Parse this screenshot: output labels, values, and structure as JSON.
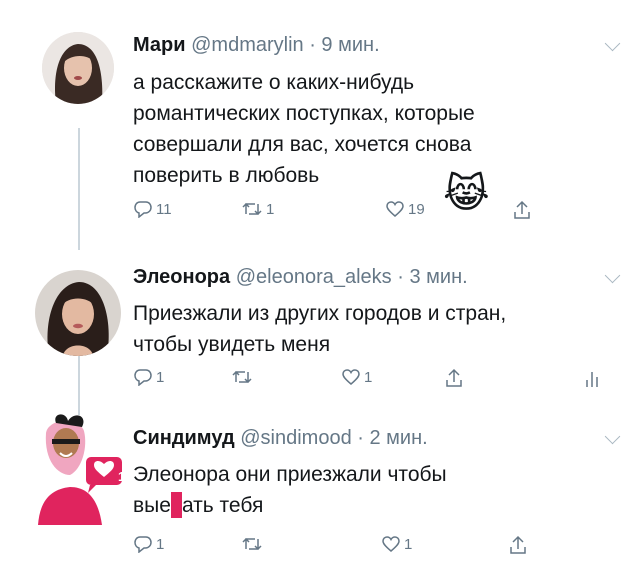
{
  "tweets": [
    {
      "name": "Мари",
      "handle": "@mdmarylin",
      "time": "· 9 мин.",
      "text": "а расскажите о каких-нибудь романтических поступках, которые совершали для вас, хочется снова поверить в любовь",
      "emoji": "😹",
      "replies": "11",
      "retweets": "1",
      "likes": "19",
      "icons": [
        "reply-icon",
        "retweet-icon",
        "like-icon",
        "share-icon",
        "crying-laughing-cat-emoji"
      ]
    },
    {
      "name": "Элеонора",
      "handle": "@eleonora_aleks",
      "time": "· 3 мин.",
      "text_lines": [
        "Приезжали из других городов и стран,",
        "чтобы увидеть меня"
      ],
      "replies": "1",
      "retweets": "",
      "likes": "1",
      "icons": [
        "reply-icon",
        "retweet-icon",
        "like-icon",
        "share-icon",
        "analytics-icon"
      ]
    },
    {
      "name": "Синдимуд",
      "handle": "@sindimood",
      "time": "· 2 мин.",
      "text_line1": "Элеонора они приезжали чтобы",
      "text_line2_start": "вые",
      "text_line2_end": "ать тебя",
      "replies": "1",
      "retweets": "",
      "likes": "1",
      "badge_count": "1",
      "icons": [
        "reply-icon",
        "retweet-icon",
        "like-icon",
        "share-icon",
        "cartoon-avatar-icon"
      ]
    }
  ],
  "colors": {
    "text": "#14171a",
    "muted": "#657786",
    "thread_line": "#ccd6dd",
    "censor_bar": "#e0245e",
    "avatar3_bg": "#e0245e"
  }
}
